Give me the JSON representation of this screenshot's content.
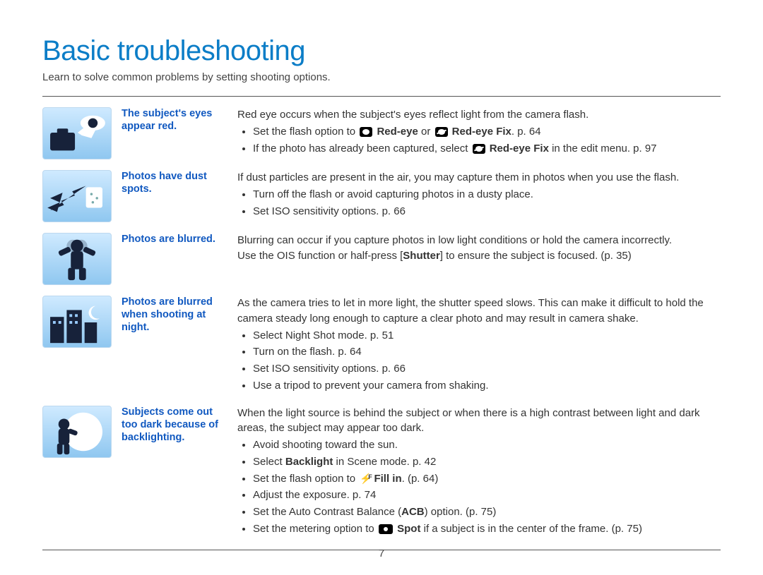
{
  "page_title": "Basic troubleshooting",
  "subtitle": "Learn to solve common problems by setting shooting options.",
  "page_number": "7",
  "rows": [
    {
      "label": "The subject's eyes appear red.",
      "intro": "Red eye occurs when the subject's eyes reflect light from the camera flash.",
      "bullets": [
        {
          "pre": "Set the flash option to ",
          "icon": "eye",
          "mid": " ",
          "bold1": "Red-eye",
          "aft": " or ",
          "icon2": "eye-fix",
          "mid2": " ",
          "bold2": "Red-eye Fix",
          "suffix": ". p. 64"
        },
        {
          "pre": "If the photo has already been captured, select ",
          "icon": "eye-fix",
          "mid": " ",
          "bold1": "Red-eye Fix",
          "aft": " in the edit menu. p. 97"
        }
      ]
    },
    {
      "label": "Photos have dust spots.",
      "intro": "If dust particles are present in the air, you may capture them in photos when you use the flash.",
      "bullets": [
        {
          "plain": "Turn off the flash or avoid capturing photos in a dusty place."
        },
        {
          "plain": "Set ISO sensitivity options. p. 66"
        }
      ]
    },
    {
      "label": "Photos are blurred.",
      "intro_a": "Blurring can occur if you capture photos in low light conditions or hold the camera incorrectly.",
      "intro_b_pre": "Use the OIS function or half-press [",
      "intro_b_bold": "Shutter",
      "intro_b_suf": "] to ensure the subject is focused. (p. 35)"
    },
    {
      "label": "Photos are blurred when shooting at night.",
      "intro": "As the camera tries to let in more light, the shutter speed slows. This can make it difficult to hold the camera steady long enough to capture a clear photo and may result in camera shake.",
      "bullets": [
        {
          "plain": "Select Night Shot mode. p. 51"
        },
        {
          "plain": "Turn on the flash. p. 64"
        },
        {
          "plain": "Set ISO sensitivity options. p. 66"
        },
        {
          "plain": "Use a tripod to prevent your camera from shaking."
        }
      ]
    },
    {
      "label": "Subjects come out too dark because of backlighting.",
      "intro": "When the light source is behind the subject or when there is a high contrast between light and dark areas, the subject may appear too dark.",
      "bullets": [
        {
          "plain": "Avoid shooting toward the sun."
        },
        {
          "pre": "Select ",
          "bold1": "Backlight",
          "aft": " in Scene mode. p. 42"
        },
        {
          "pre": "Set the flash option to ",
          "icon": "flash-f",
          "mid": " ",
          "bold1": "Fill in",
          "aft": ". (p. 64)"
        },
        {
          "plain": "Adjust the exposure. p. 74"
        },
        {
          "pre": "Set the Auto Contrast Balance (",
          "bold1": "ACB",
          "aft": ") option. (p. 75)"
        },
        {
          "pre": "Set the metering option to ",
          "icon": "spot",
          "mid": " ",
          "bold1": "Spot",
          "aft": " if a subject is in the center of the frame. (p. 75)"
        }
      ]
    }
  ]
}
